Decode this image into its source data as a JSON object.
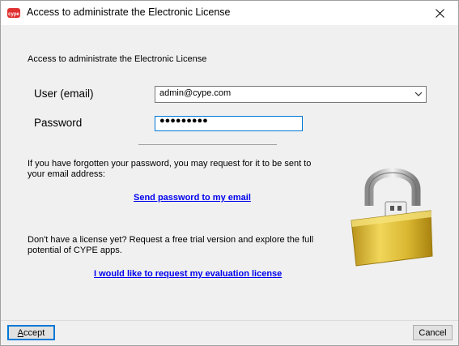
{
  "window": {
    "title": "Access to administrate the Electronic License",
    "app_icon": "cype-logo-icon",
    "close_glyph": "✕"
  },
  "header": {
    "text": "Access to administrate the Electronic License"
  },
  "form": {
    "user_label": "User (email)",
    "user_value": "admin@cype.com",
    "password_label": "Password",
    "password_mask": "●●●●●●●●●"
  },
  "forgot": {
    "text": "If you have forgotten your password, you may request for it to be sent to your email address:",
    "link": "Send password to my email"
  },
  "trial": {
    "text": "Don't have a license yet? Request a free trial version and explore the full potential of CYPE apps.",
    "link": "I would like to request my evaluation license"
  },
  "buttons": {
    "accept": "Accept",
    "cancel": "Cancel"
  },
  "colors": {
    "link": "#0000ee",
    "focus": "#0078d7",
    "lock_gold": "#d9b630",
    "brand_red": "#e03030"
  }
}
